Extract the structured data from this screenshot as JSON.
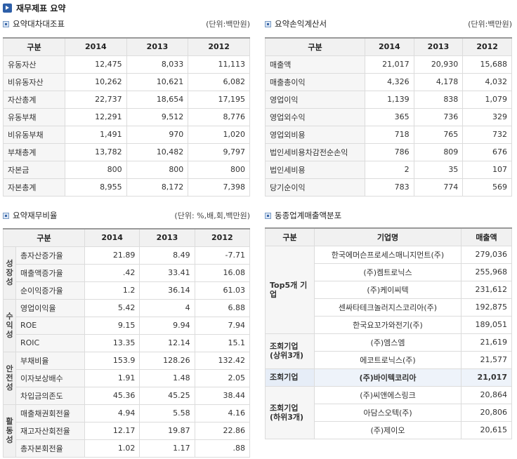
{
  "main_title": "재무제표 요약",
  "balance": {
    "title": "요약대차대조표",
    "unit": "(단위:백만원)",
    "headers": [
      "구분",
      "2014",
      "2013",
      "2012"
    ],
    "rows": [
      {
        "label": "유동자산",
        "v": [
          "12,475",
          "8,033",
          "11,113"
        ]
      },
      {
        "label": "비유동자산",
        "v": [
          "10,262",
          "10,621",
          "6,082"
        ]
      },
      {
        "label": "자산총계",
        "v": [
          "22,737",
          "18,654",
          "17,195"
        ]
      },
      {
        "label": "유동부채",
        "v": [
          "12,291",
          "9,512",
          "8,776"
        ]
      },
      {
        "label": "비유동부채",
        "v": [
          "1,491",
          "970",
          "1,020"
        ]
      },
      {
        "label": "부채총계",
        "v": [
          "13,782",
          "10,482",
          "9,797"
        ]
      },
      {
        "label": "자본금",
        "v": [
          "800",
          "800",
          "800"
        ]
      },
      {
        "label": "자본총계",
        "v": [
          "8,955",
          "8,172",
          "7,398"
        ]
      }
    ]
  },
  "income": {
    "title": "요약손익계산서",
    "unit": "(단위:백만원)",
    "headers": [
      "구분",
      "2014",
      "2013",
      "2012"
    ],
    "rows": [
      {
        "label": "매출액",
        "v": [
          "21,017",
          "20,930",
          "15,688"
        ]
      },
      {
        "label": "매출총이익",
        "v": [
          "4,326",
          "4,178",
          "4,032"
        ]
      },
      {
        "label": "영업이익",
        "v": [
          "1,139",
          "838",
          "1,079"
        ]
      },
      {
        "label": "영업외수익",
        "v": [
          "365",
          "736",
          "329"
        ]
      },
      {
        "label": "영업외비용",
        "v": [
          "718",
          "765",
          "732"
        ]
      },
      {
        "label": "법인세비용차감전순손익",
        "v": [
          "786",
          "809",
          "676"
        ]
      },
      {
        "label": "법인세비용",
        "v": [
          "2",
          "35",
          "107"
        ]
      },
      {
        "label": "당기순이익",
        "v": [
          "783",
          "774",
          "569"
        ]
      }
    ]
  },
  "ratios": {
    "title": "요약재무비율",
    "unit": "(단위: %,배,회,백만원)",
    "headers": [
      "구분",
      "2014",
      "2013",
      "2012"
    ],
    "groups": [
      {
        "category": "성장성",
        "rows": [
          {
            "label": "총자산증가율",
            "v": [
              "21.89",
              "8.49",
              "-7.71"
            ]
          },
          {
            "label": "매출액증가율",
            "v": [
              ".42",
              "33.41",
              "16.08"
            ]
          },
          {
            "label": "순이익증가율",
            "v": [
              "1.2",
              "36.14",
              "61.03"
            ]
          }
        ]
      },
      {
        "category": "수익성",
        "rows": [
          {
            "label": "영업이익율",
            "v": [
              "5.42",
              "4",
              "6.88"
            ]
          },
          {
            "label": "ROE",
            "v": [
              "9.15",
              "9.94",
              "7.94"
            ]
          },
          {
            "label": "ROIC",
            "v": [
              "13.35",
              "12.14",
              "15.1"
            ]
          }
        ]
      },
      {
        "category": "안전성",
        "rows": [
          {
            "label": "부채비율",
            "v": [
              "153.9",
              "128.26",
              "132.42"
            ]
          },
          {
            "label": "이자보상배수",
            "v": [
              "1.91",
              "1.48",
              "2.05"
            ]
          },
          {
            "label": "차입금의존도",
            "v": [
              "45.36",
              "45.25",
              "38.44"
            ]
          }
        ]
      },
      {
        "category": "활동성",
        "rows": [
          {
            "label": "매출채권회전율",
            "v": [
              "4.94",
              "5.58",
              "4.16"
            ]
          },
          {
            "label": "재고자산회전율",
            "v": [
              "12.17",
              "19.87",
              "22.86"
            ]
          },
          {
            "label": "총자본회전율",
            "v": [
              "1.02",
              "1.17",
              ".88"
            ]
          }
        ]
      }
    ]
  },
  "peers": {
    "title": "동종업계매출액분포",
    "headers": [
      "구분",
      "기업명",
      "매출액"
    ],
    "groups": [
      {
        "label": "Top5개 기업",
        "highlight": false,
        "rows": [
          {
            "name": "한국에머슨프로세스매니지먼트(주)",
            "sales": "279,036"
          },
          {
            "name": "(주)켐트로닉스",
            "sales": "255,968"
          },
          {
            "name": "(주)케이씨텍",
            "sales": "231,612"
          },
          {
            "name": "센싸타테크놀러지스코리아(주)",
            "sales": "192,875"
          },
          {
            "name": "한국요꼬가와전기(주)",
            "sales": "189,051"
          }
        ]
      },
      {
        "label": "조회기업 (상위3개)",
        "highlight": false,
        "rows": [
          {
            "name": "(주)엠스엠",
            "sales": "21,619"
          },
          {
            "name": "에코트로닉스(주)",
            "sales": "21,577"
          }
        ]
      },
      {
        "label": "조회기업",
        "highlight": true,
        "rows": [
          {
            "name": "(주)바이텍코리아",
            "sales": "21,017"
          }
        ]
      },
      {
        "label": "조회기업 (하위3개)",
        "highlight": false,
        "rows": [
          {
            "name": "(주)씨앤에스링크",
            "sales": "20,864"
          },
          {
            "name": "아담스오텍(주)",
            "sales": "20,806"
          },
          {
            "name": "(주)제이오",
            "sales": "20,615"
          }
        ]
      }
    ]
  }
}
